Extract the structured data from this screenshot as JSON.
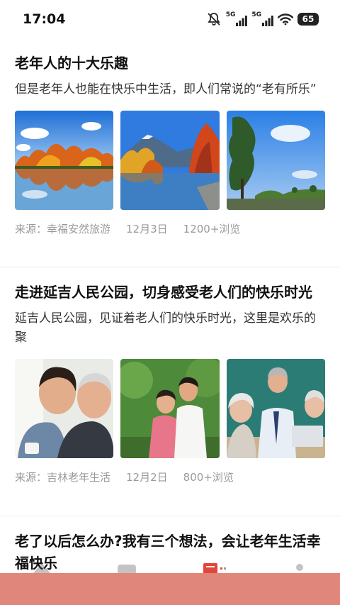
{
  "status_bar": {
    "time": "17:04",
    "battery": "65",
    "net1": "5G",
    "net2": "5G"
  },
  "articles": [
    {
      "title": "老年人的十大乐趣",
      "summary": "但是老年人也能在快乐中生活，即人们常说的“老有所乐”",
      "source": "来源：幸福安然旅游",
      "date": "12月3日",
      "views": "1200+浏览",
      "images": [
        "autumn-lake-reflection",
        "mountain-lake-autumn-trees",
        "park-trees-blue-sky"
      ]
    },
    {
      "title": "走进延吉人民公园，切身感受老人们的快乐时光",
      "summary": "延吉人民公园，见证着老人们的快乐时光，这里是欢乐的聚",
      "source": "来源：吉林老年生活",
      "date": "12月2日",
      "views": "800+浏览",
      "images": [
        "elderly-couple-smiling",
        "couple-in-park",
        "seniors-with-laptop"
      ]
    },
    {
      "title": "老了以后怎么办?我有三个想法，会让老年生活幸福快乐"
    }
  ],
  "bottom_nav": {
    "icons": [
      "home-icon",
      "video-icon",
      "news-icon",
      "profile-icon"
    ]
  },
  "colors": {
    "accent": "#e0473a",
    "overlay": "#e0867a",
    "meta_text": "#9a9a9a"
  }
}
